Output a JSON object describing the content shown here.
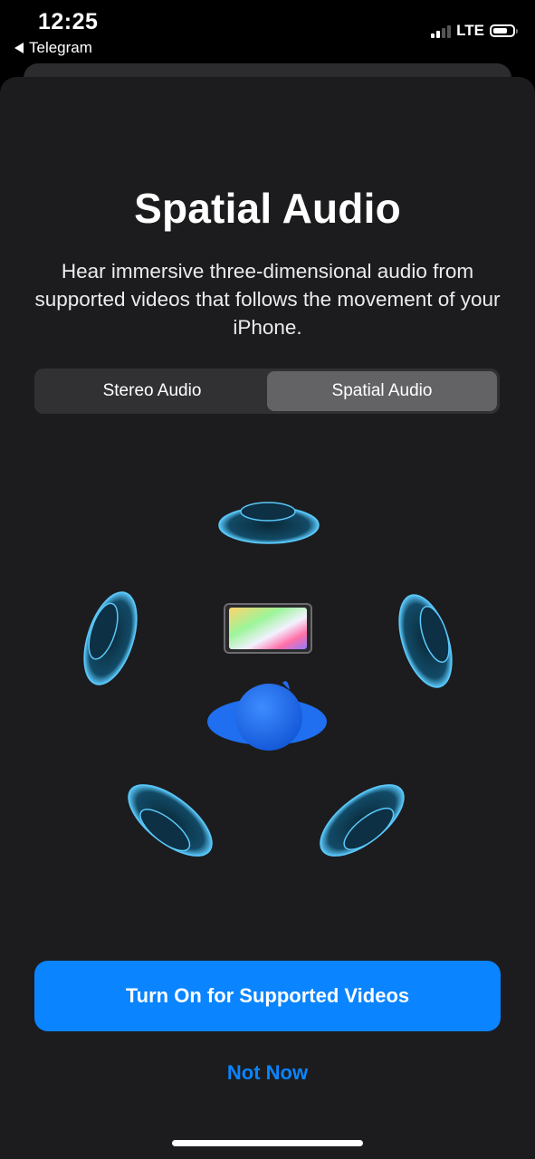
{
  "status_bar": {
    "time": "12:25",
    "back_label": "Telegram",
    "network": "LTE",
    "signal_bars_active": 2,
    "signal_bars_total": 4
  },
  "sheet": {
    "title": "Spatial Audio",
    "description": "Hear immersive three-dimensional audio from supported videos that follows the movement of your iPhone.",
    "segments": [
      {
        "label": "Stereo Audio",
        "selected": false
      },
      {
        "label": "Spatial Audio",
        "selected": true
      }
    ],
    "illustration_icons": [
      "speaker-top-icon",
      "speaker-left-icon",
      "speaker-right-icon",
      "speaker-bottom-left-icon",
      "speaker-bottom-right-icon",
      "ipad-screen-icon",
      "listener-head-icon"
    ],
    "primary_button": "Turn On for Supported Videos",
    "secondary_button": "Not Now"
  },
  "colors": {
    "accent": "#0a84ff",
    "sheet_background": "#1c1c1e",
    "speaker_glow": "#5ac8fa",
    "listener": "#1f6ff0"
  }
}
